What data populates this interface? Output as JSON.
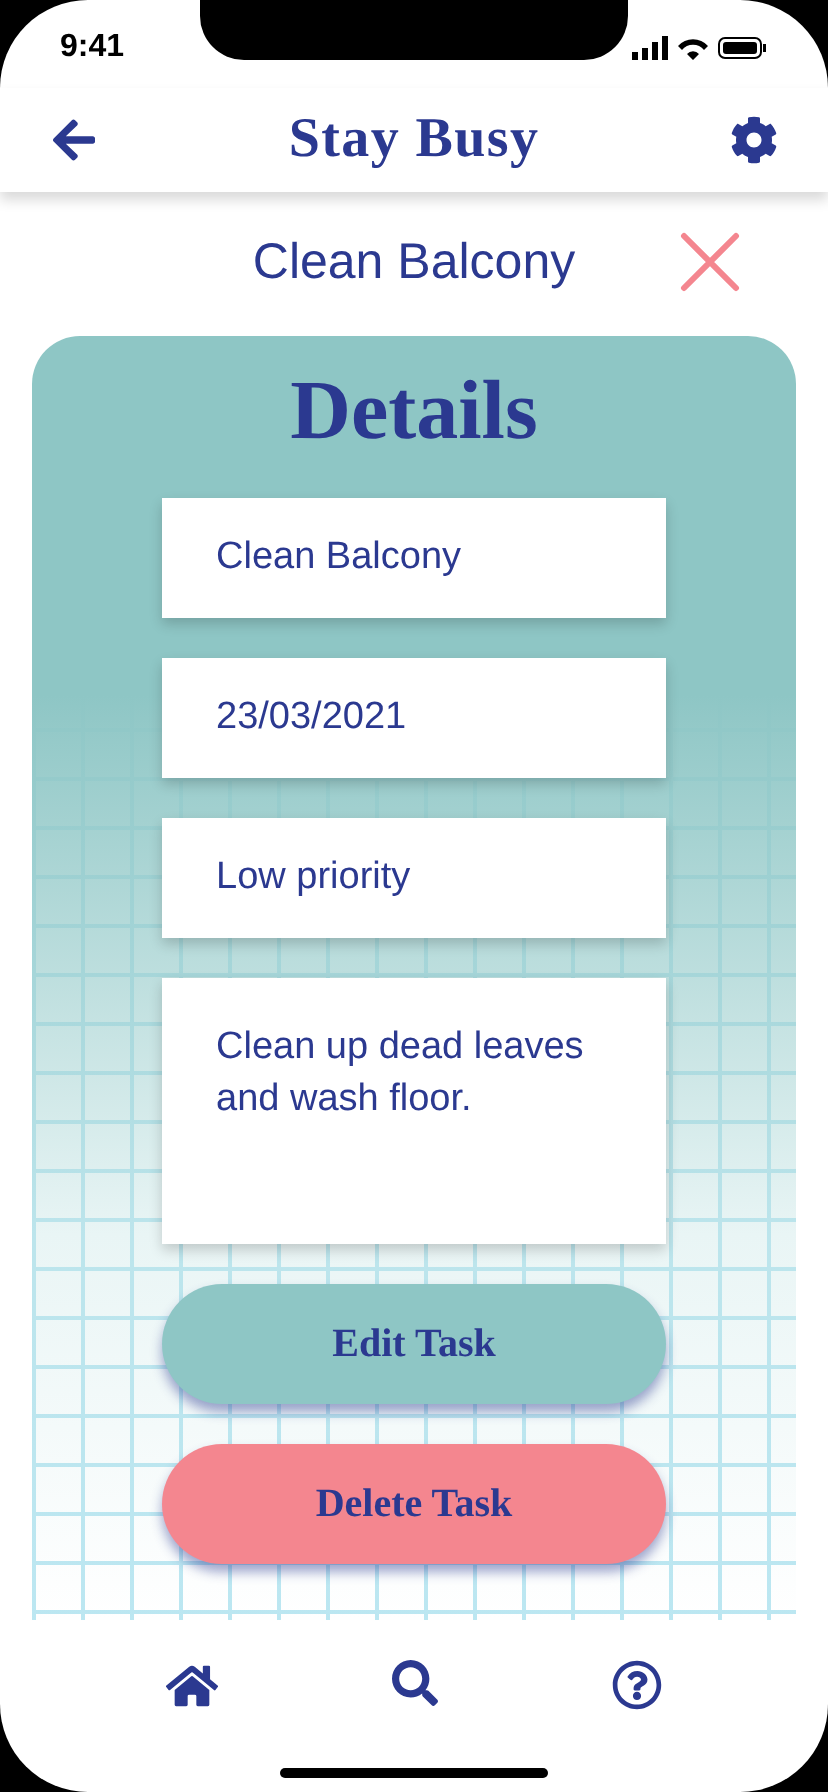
{
  "status_bar": {
    "time": "9:41"
  },
  "header": {
    "title": "Stay Busy"
  },
  "task": {
    "title": "Clean Balcony"
  },
  "details": {
    "heading": "Details",
    "fields": [
      {
        "kind": "line",
        "value": "Clean Balcony"
      },
      {
        "kind": "line",
        "value": "23/03/2021"
      },
      {
        "kind": "line",
        "value": "Low priority"
      },
      {
        "kind": "area",
        "value": "Clean up dead leaves and wash floor."
      }
    ],
    "buttons": [
      {
        "kind": "edit",
        "label": "Edit Task"
      },
      {
        "kind": "delete",
        "label": "Delete Task"
      }
    ]
  }
}
